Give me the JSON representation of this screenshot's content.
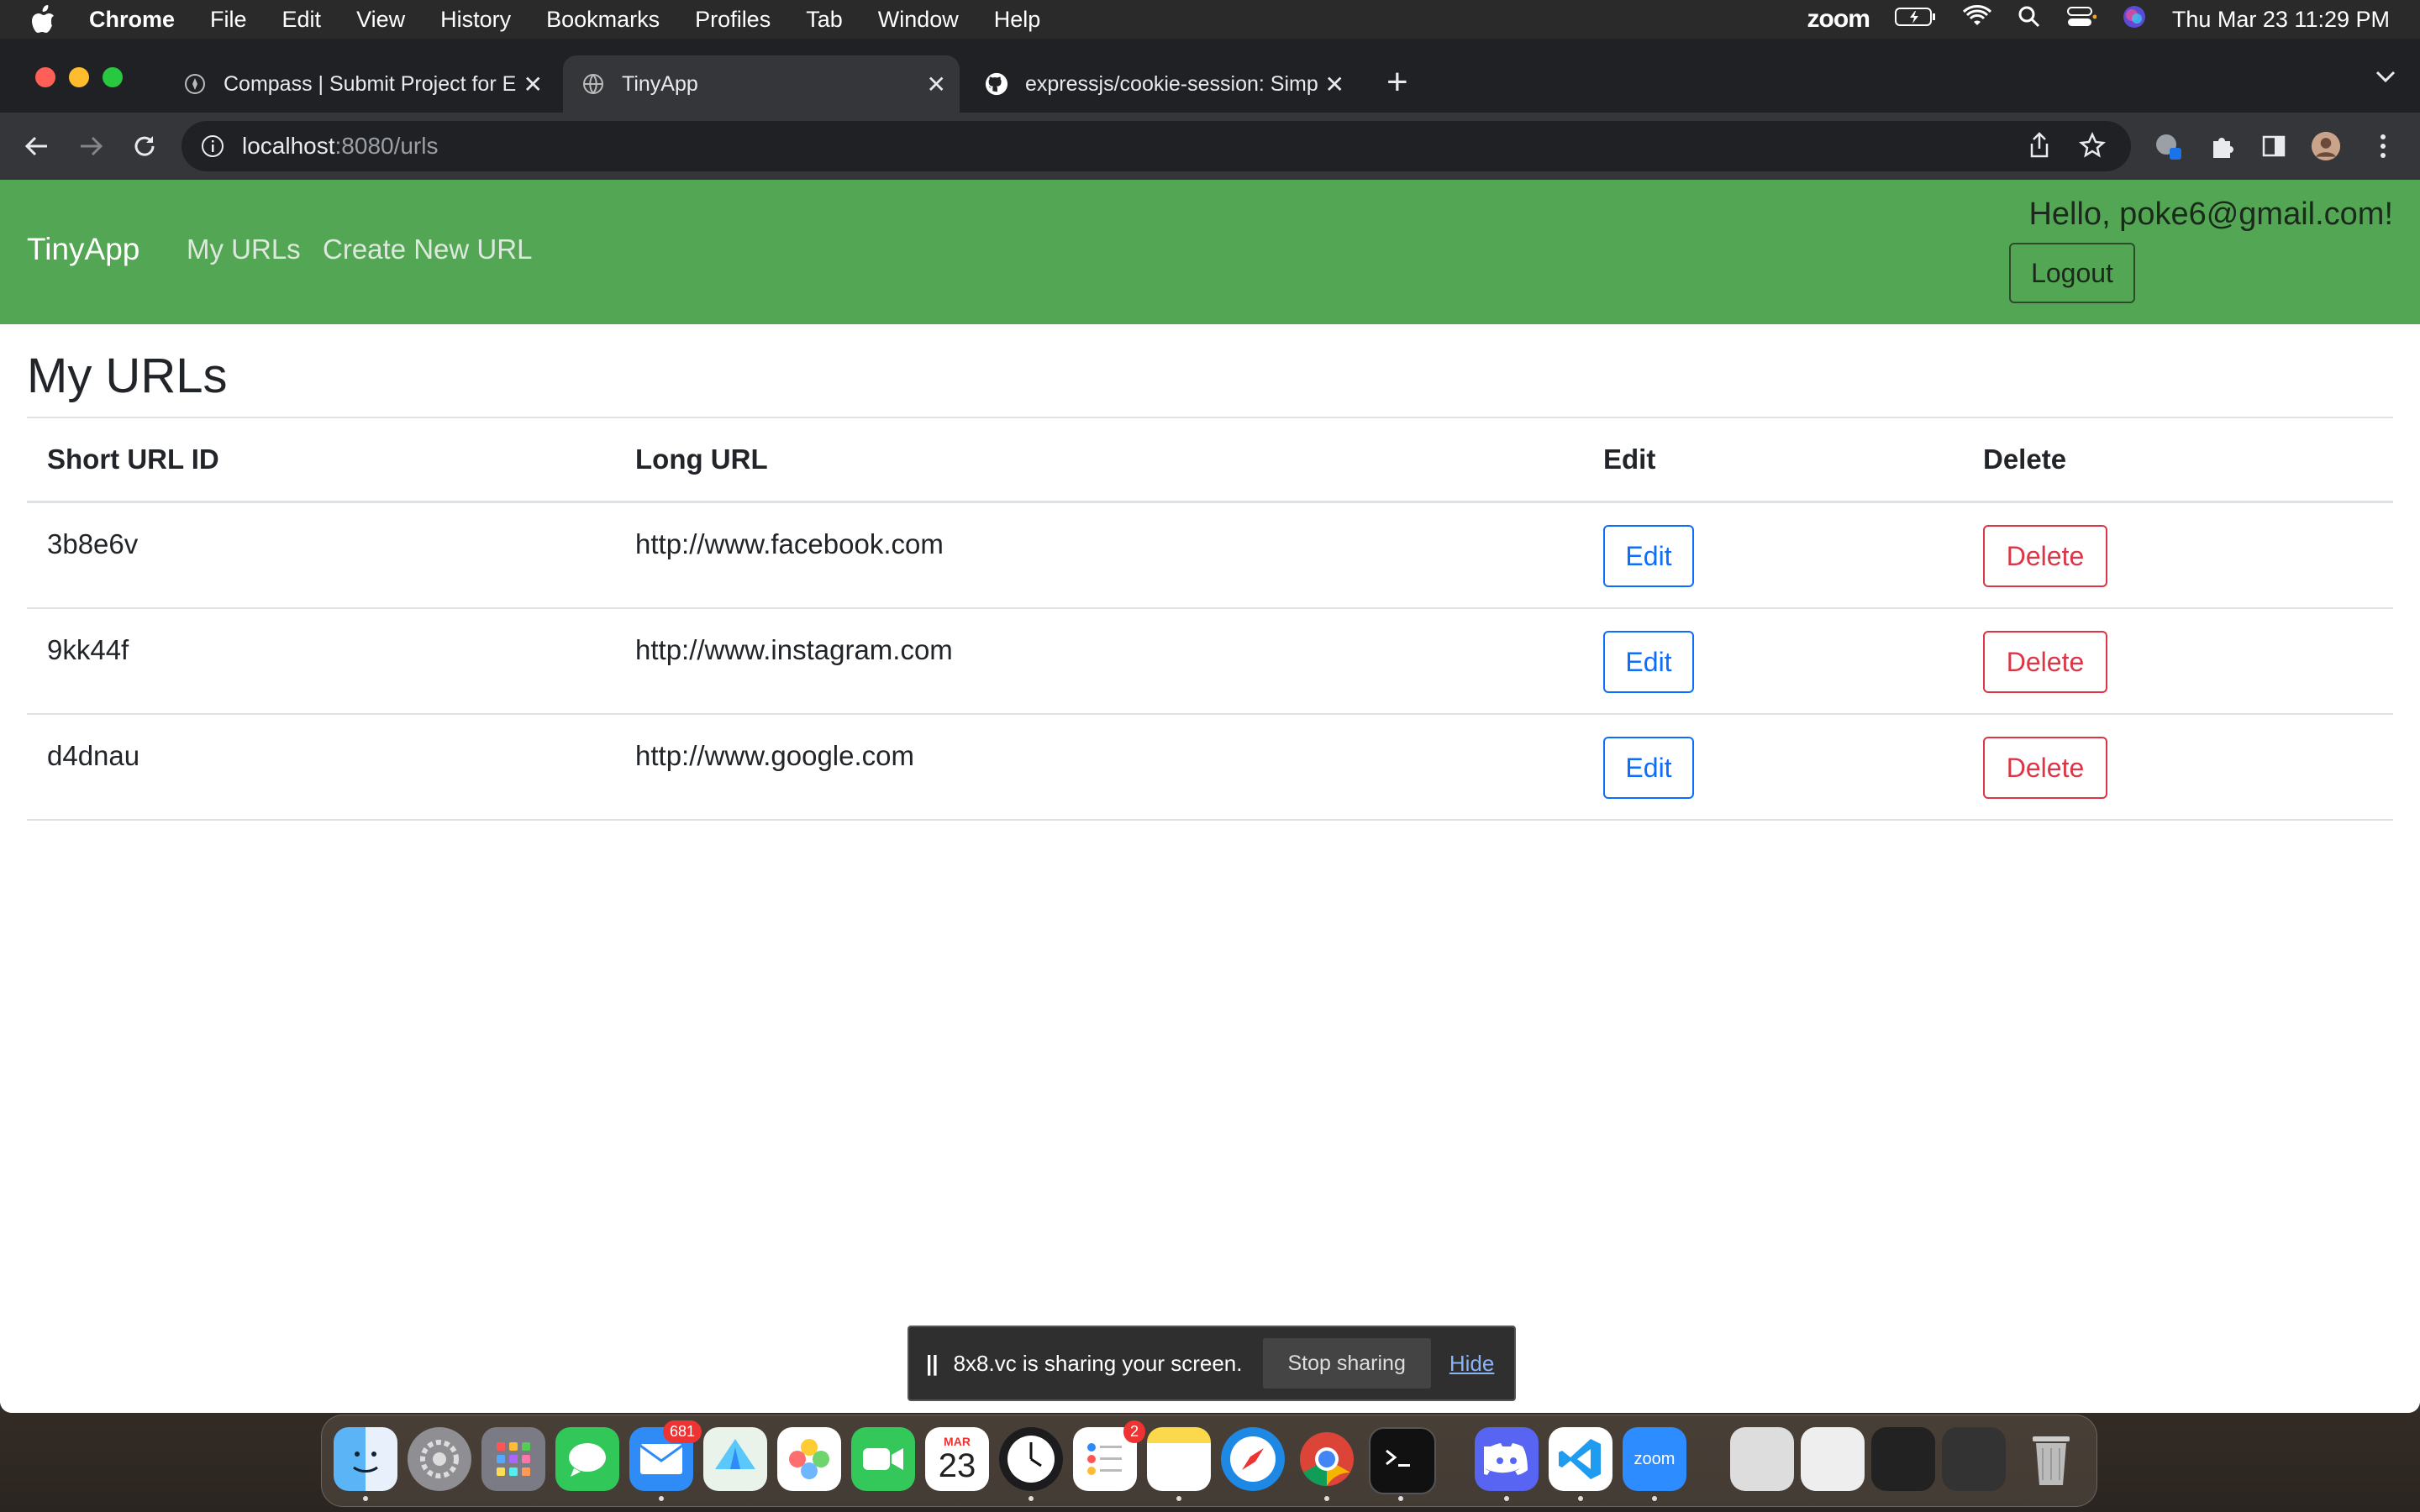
{
  "menubar": {
    "app": "Chrome",
    "items": [
      "File",
      "Edit",
      "View",
      "History",
      "Bookmarks",
      "Profiles",
      "Tab",
      "Window",
      "Help"
    ],
    "zoom": "zoom",
    "clock": "Thu Mar 23  11:29 PM"
  },
  "tabs": [
    {
      "title": "Compass | Submit Project for E",
      "icon": "compass-icon"
    },
    {
      "title": "TinyApp",
      "icon": "globe-icon"
    },
    {
      "title": "expressjs/cookie-session: Simp",
      "icon": "github-icon"
    }
  ],
  "address": {
    "host": "localhost",
    "path": ":8080/urls"
  },
  "site": {
    "brand": "TinyApp",
    "nav": [
      "My URLs",
      "Create New URL"
    ],
    "greeting": "Hello, poke6@gmail.com!",
    "logout_label": "Logout",
    "heading": "My URLs"
  },
  "table": {
    "headers": [
      "Short URL ID",
      "Long URL",
      "Edit",
      "Delete"
    ],
    "rows": [
      {
        "id": "3b8e6v",
        "url": "http://www.facebook.com",
        "edit": "Edit",
        "delete": "Delete"
      },
      {
        "id": "9kk44f",
        "url": "http://www.instagram.com",
        "edit": "Edit",
        "delete": "Delete"
      },
      {
        "id": "d4dnau",
        "url": "http://www.google.com",
        "edit": "Edit",
        "delete": "Delete"
      }
    ]
  },
  "share_banner": {
    "message": "8x8.vc is sharing your screen.",
    "stop_label": "Stop sharing",
    "hide_label": "Hide"
  },
  "dock": {
    "mail_badge": "681",
    "reminders_badge": "2",
    "calendar_month": "MAR",
    "calendar_day": "23",
    "zoom_label": "zoom"
  },
  "colors": {
    "navbar": "#53a653",
    "edit_button": "#0d6efd",
    "delete_button": "#dc3545"
  }
}
